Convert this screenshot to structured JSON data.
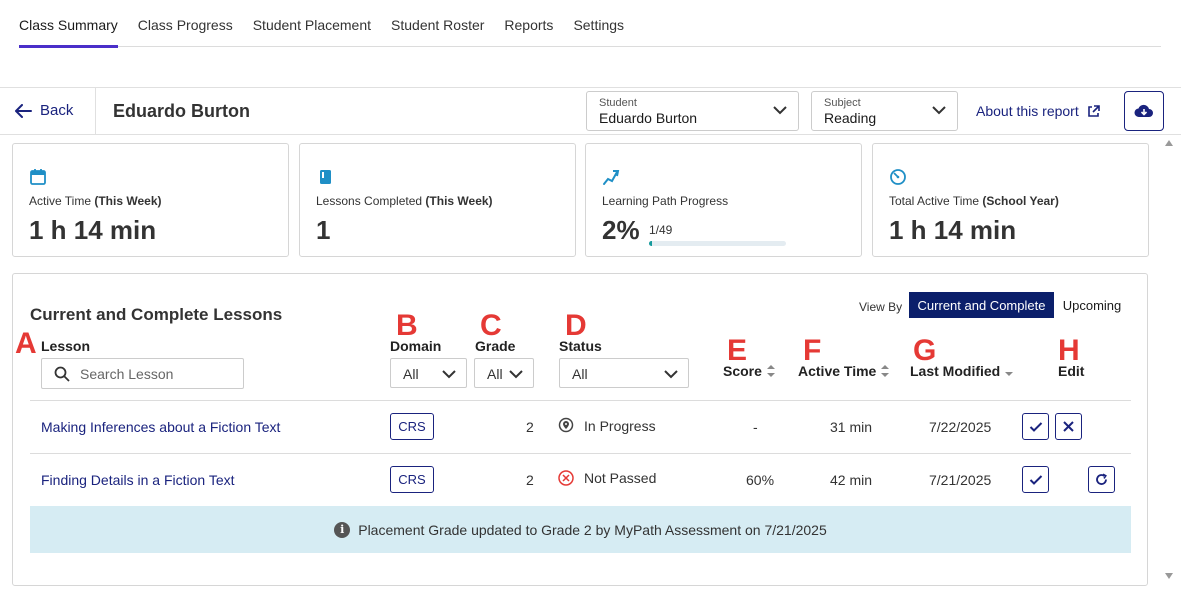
{
  "tabs": [
    {
      "label": "Class Summary",
      "active": true
    },
    {
      "label": "Class Progress"
    },
    {
      "label": "Student Placement"
    },
    {
      "label": "Student Roster"
    },
    {
      "label": "Reports"
    },
    {
      "label": "Settings"
    }
  ],
  "header": {
    "back_label": "Back",
    "student_name": "Eduardo Burton",
    "student_select": {
      "label": "Student",
      "value": "Eduardo Burton"
    },
    "subject_select": {
      "label": "Subject",
      "value": "Reading"
    },
    "about_label": "About this report",
    "download_icon": "cloud-download-icon"
  },
  "cards": [
    {
      "icon": "calendar-icon",
      "title": "Active Time ",
      "title_bold": "(This Week)",
      "value": "1 h 14 min"
    },
    {
      "icon": "book-icon",
      "title": "Lessons Completed ",
      "title_bold": "(This Week)",
      "value": "1"
    },
    {
      "icon": "path-icon",
      "title": "Learning Path Progress",
      "title_bold": "",
      "value": "2%",
      "fraction": "1/49",
      "progress": 0.02
    },
    {
      "icon": "timer-icon",
      "title": "Total Active Time ",
      "title_bold": "(School Year)",
      "value": "1 h 14 min"
    }
  ],
  "lessons": {
    "title": "Current and Complete Lessons",
    "view_by_label": "View By",
    "view_options": [
      "Current and Complete",
      "Upcoming"
    ],
    "markers": [
      "A",
      "B",
      "C",
      "D",
      "E",
      "F",
      "G",
      "H"
    ],
    "columns": {
      "lesson": "Lesson",
      "domain": "Domain",
      "grade": "Grade",
      "status": "Status",
      "score": "Score",
      "active_time": "Active Time",
      "last_modified": "Last Modified",
      "edit": "Edit"
    },
    "search_placeholder": "Search Lesson",
    "filters": {
      "domain": "All",
      "grade": "All",
      "status": "All"
    },
    "rows": [
      {
        "lesson": "Making Inferences about a Fiction Text",
        "domain": "CRS",
        "grade": "2",
        "status": "In Progress",
        "status_icon": "location-pin-icon",
        "score": "-",
        "active_time": "31 min",
        "last_modified": "7/22/2025"
      },
      {
        "lesson": "Finding Details in a Fiction Text",
        "domain": "CRS",
        "grade": "2",
        "status": "Not Passed",
        "status_icon": "x-circle-icon",
        "score": "60%",
        "active_time": "42 min",
        "last_modified": "7/21/2025"
      }
    ],
    "notice": "Placement Grade updated to Grade 2 by MyPath Assessment on 7/21/2025"
  },
  "colors": {
    "accent": "#4a2fc9",
    "navy": "#1a237e",
    "active_btn": "#0b1f6b",
    "marker": "#e53935",
    "notice_bg": "#d6ecf3",
    "teal": "#159a9c"
  }
}
